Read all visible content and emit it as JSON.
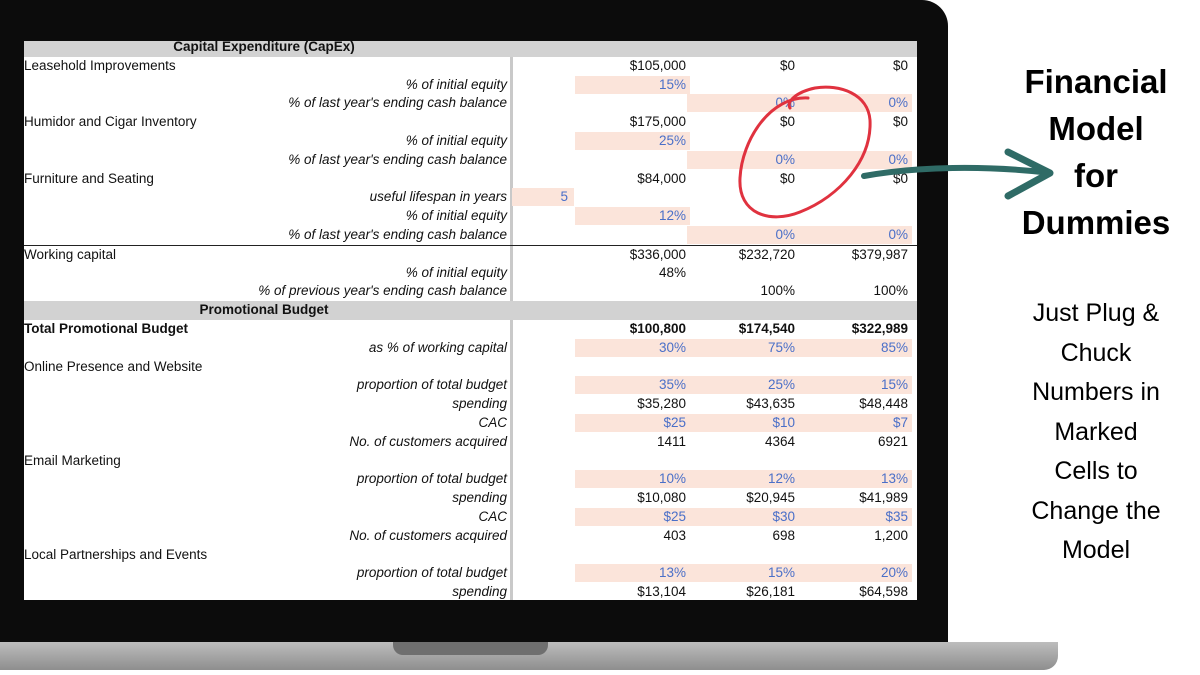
{
  "sheet": {
    "rows": [
      {
        "type": "section",
        "label": "Capital Expenditure (CapEx)"
      },
      {
        "type": "main",
        "label": "Leasehold Improvements",
        "c": "$105,000",
        "d": "$0",
        "e": "$0"
      },
      {
        "type": "sub",
        "label": "% of initial equity",
        "c": "15%",
        "cShade": true,
        "cBlue": true
      },
      {
        "type": "sub",
        "label": "% of last year's ending cash balance",
        "d": "0%",
        "e": "0%",
        "dShade": true,
        "eShade": true,
        "dBlue": true,
        "eBlue": true
      },
      {
        "type": "main",
        "label": "Humidor and Cigar Inventory",
        "c": "$175,000",
        "d": "$0",
        "e": "$0"
      },
      {
        "type": "sub",
        "label": "% of initial equity",
        "c": "25%",
        "cShade": true,
        "cBlue": true
      },
      {
        "type": "sub",
        "label": "% of last year's ending cash balance",
        "d": "0%",
        "e": "0%",
        "dShade": true,
        "eShade": true,
        "dBlue": true,
        "eBlue": true
      },
      {
        "type": "main",
        "label": "Furniture and Seating",
        "c": "$84,000",
        "d": "$0",
        "e": "$0"
      },
      {
        "type": "sub",
        "label": "useful lifespan in years",
        "b": "5",
        "bShade": true,
        "bBlue": true
      },
      {
        "type": "sub",
        "label": "% of initial equity",
        "c": "12%",
        "cShade": true,
        "cBlue": true
      },
      {
        "type": "sub",
        "label": "% of last year's ending cash balance",
        "d": "0%",
        "e": "0%",
        "dShade": true,
        "eShade": true,
        "dBlue": true,
        "eBlue": true
      },
      {
        "type": "main",
        "label": "Working capital",
        "c": "$336,000",
        "d": "$232,720",
        "e": "$379,987",
        "ruled": true
      },
      {
        "type": "sub",
        "label": "% of initial equity",
        "c": "48%"
      },
      {
        "type": "sub",
        "label": "% of previous year's ending cash balance",
        "d": "100%",
        "e": "100%"
      },
      {
        "type": "section",
        "label": "Promotional Budget"
      },
      {
        "type": "main",
        "label": "Total Promotional Budget",
        "c": "$100,800",
        "d": "$174,540",
        "e": "$322,989",
        "bold": true
      },
      {
        "type": "sub",
        "label": "as % of working capital",
        "c": "30%",
        "d": "75%",
        "e": "85%",
        "cShade": true,
        "dShade": true,
        "eShade": true,
        "cBlue": true,
        "dBlue": true,
        "eBlue": true
      },
      {
        "type": "main",
        "label": "Online Presence and Website"
      },
      {
        "type": "sub",
        "label": "proportion of total budget",
        "c": "35%",
        "d": "25%",
        "e": "15%",
        "cShade": true,
        "dShade": true,
        "eShade": true,
        "cBlue": true,
        "dBlue": true,
        "eBlue": true
      },
      {
        "type": "sub",
        "label": "spending",
        "c": "$35,280",
        "d": "$43,635",
        "e": "$48,448"
      },
      {
        "type": "sub",
        "label": "CAC",
        "c": "$25",
        "d": "$10",
        "e": "$7",
        "cShade": true,
        "dShade": true,
        "eShade": true,
        "cBlue": true,
        "dBlue": true,
        "eBlue": true
      },
      {
        "type": "sub",
        "label": "No. of customers acquired",
        "c": "1411",
        "d": "4364",
        "e": "6921"
      },
      {
        "type": "main",
        "label": "Email Marketing"
      },
      {
        "type": "sub",
        "label": "proportion of total budget",
        "c": "10%",
        "d": "12%",
        "e": "13%",
        "cShade": true,
        "dShade": true,
        "eShade": true,
        "cBlue": true,
        "dBlue": true,
        "eBlue": true
      },
      {
        "type": "sub",
        "label": "spending",
        "c": "$10,080",
        "d": "$20,945",
        "e": "$41,989"
      },
      {
        "type": "sub",
        "label": "CAC",
        "c": "$25",
        "d": "$30",
        "e": "$35",
        "cShade": true,
        "dShade": true,
        "eShade": true,
        "cBlue": true,
        "dBlue": true,
        "eBlue": true
      },
      {
        "type": "sub",
        "label": "No. of customers acquired",
        "c": "403",
        "d": "698",
        "e": "1,200"
      },
      {
        "type": "main",
        "label": "Local Partnerships and Events"
      },
      {
        "type": "sub",
        "label": "proportion of total budget",
        "c": "13%",
        "d": "15%",
        "e": "20%",
        "cShade": true,
        "dShade": true,
        "eShade": true,
        "cBlue": true,
        "dBlue": true,
        "eBlue": true
      },
      {
        "type": "sub",
        "label": "spending",
        "c": "$13,104",
        "d": "$26,181",
        "e": "$64,598"
      }
    ]
  },
  "headline": {
    "lines": [
      "Financial",
      "Model",
      "for",
      "Dummies"
    ]
  },
  "caption": {
    "lines": [
      "Just Plug &",
      "Chuck",
      "Numbers in",
      "Marked",
      "Cells to",
      "Change the",
      "Model"
    ]
  },
  "annotation": {
    "circle_icon": "red-hand-drawn-circle",
    "arrow_icon": "teal-curved-arrow",
    "colors": {
      "circle": "#e0323f",
      "arrow": "#2f6b66",
      "input_shade": "#fbe4da",
      "input_text": "#4a6fc8",
      "section_bg": "#d2d2d2"
    }
  }
}
